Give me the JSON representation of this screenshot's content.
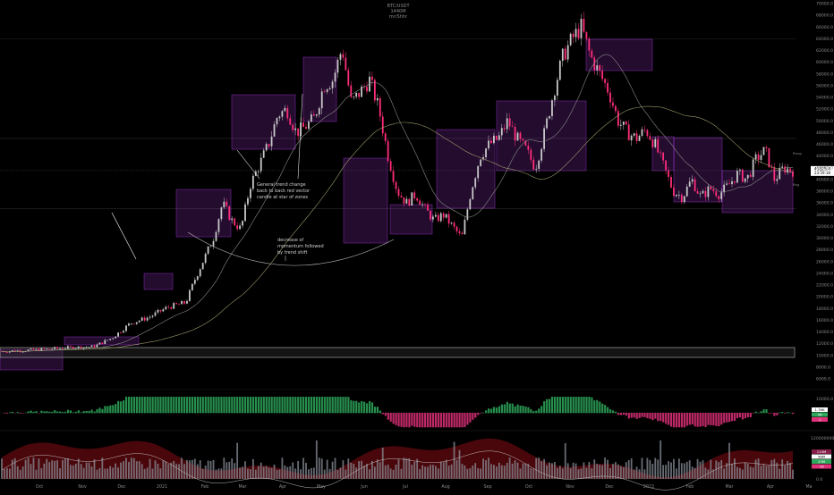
{
  "header": {
    "symbol": "BTC/USDT",
    "interval": "1440M",
    "author": "mr/Shhr"
  },
  "chart_data": {
    "type": "candlestick",
    "price_axis_labels": [
      70000,
      68000,
      66000,
      64000,
      62000,
      60000,
      58000,
      56000,
      54000,
      52000,
      50000,
      48000,
      46000,
      44000,
      42000,
      40000,
      38000,
      36000,
      34000,
      32000,
      30000,
      28000,
      26000,
      24000,
      22000,
      20000,
      18000,
      16000,
      14000,
      12000,
      10000,
      8000,
      6000
    ],
    "x_axis_labels": [
      "Oct",
      "Nov",
      "Dec",
      "2021",
      "Feb",
      "Mar",
      "Apr",
      "May",
      "Jun",
      "Jul",
      "Aug",
      "Sep",
      "Oct",
      "Nov",
      "Dec",
      "2022",
      "Feb",
      "Mar",
      "Apr",
      "Ma"
    ],
    "price_path": [
      [
        0,
        10700
      ],
      [
        3,
        10900
      ],
      [
        7,
        11300
      ],
      [
        10,
        11500
      ],
      [
        12,
        13000
      ],
      [
        14,
        15500
      ],
      [
        16,
        16500
      ],
      [
        18,
        18200
      ],
      [
        20,
        19000
      ],
      [
        21,
        23000
      ],
      [
        23,
        30000
      ],
      [
        24,
        36000
      ],
      [
        25,
        33000
      ],
      [
        26,
        31500
      ],
      [
        27,
        39000
      ],
      [
        29,
        46000
      ],
      [
        30,
        51000
      ],
      [
        31,
        52000
      ],
      [
        32,
        48000
      ],
      [
        33,
        49000
      ],
      [
        34,
        50500
      ],
      [
        35,
        56000
      ],
      [
        36,
        57000
      ],
      [
        37,
        62500
      ],
      [
        38,
        53000
      ],
      [
        39,
        55000
      ],
      [
        40,
        57000
      ],
      [
        41,
        52000
      ],
      [
        42,
        44000
      ],
      [
        43,
        38000
      ],
      [
        44,
        36000
      ],
      [
        45,
        37500
      ],
      [
        46,
        35000
      ],
      [
        47,
        33000
      ],
      [
        48,
        34000
      ],
      [
        49,
        32000
      ],
      [
        50,
        30000
      ],
      [
        51,
        38000
      ],
      [
        52,
        44000
      ],
      [
        53,
        46000
      ],
      [
        54,
        47000
      ],
      [
        55,
        50000
      ],
      [
        56,
        47000
      ],
      [
        57,
        45000
      ],
      [
        58,
        42000
      ],
      [
        59,
        48000
      ],
      [
        60,
        55000
      ],
      [
        61,
        61000
      ],
      [
        62,
        64000
      ],
      [
        63,
        66000
      ],
      [
        64,
        61000
      ],
      [
        65,
        58000
      ],
      [
        66,
        55000
      ],
      [
        67,
        50000
      ],
      [
        68,
        48000
      ],
      [
        69,
        47000
      ],
      [
        70,
        48500
      ],
      [
        71,
        46000
      ],
      [
        72,
        42000
      ],
      [
        73,
        38000
      ],
      [
        74,
        37000
      ],
      [
        75,
        40000
      ],
      [
        76,
        37000
      ],
      [
        77,
        38500
      ],
      [
        78,
        37500
      ],
      [
        79,
        39000
      ],
      [
        80,
        41000
      ],
      [
        81,
        40000
      ],
      [
        82,
        43500
      ],
      [
        83,
        45000
      ],
      [
        84,
        40000
      ],
      [
        85,
        42000
      ],
      [
        86,
        41500
      ]
    ],
    "last_price": "41525.4",
    "countdown": "23:59:18",
    "annotations": [
      "General trend change back to back red vector candle at star of zones",
      "decrease of momentum followed by trend shift"
    ],
    "right_small_labels": [
      "Rnvg",
      "Rsg"
    ],
    "oscillator": {
      "levels": [
        10000,
        0
      ],
      "badges": [
        "1.76K",
        "3K",
        "-1"
      ]
    },
    "volume_panel": {
      "levels": [
        120000000,
        0
      ],
      "badges": [
        "110M",
        "58M",
        "23M",
        "-32"
      ]
    },
    "colors": {
      "up": "#c8c8c8",
      "down": "#ff2d7a",
      "zone": "#c040ff",
      "ema1": "#8a8a8a",
      "ema2": "#9f9a6a",
      "osc_up": "#2ea85a",
      "osc_down": "#e0307a",
      "vol_bg": "#6a0a10"
    }
  }
}
